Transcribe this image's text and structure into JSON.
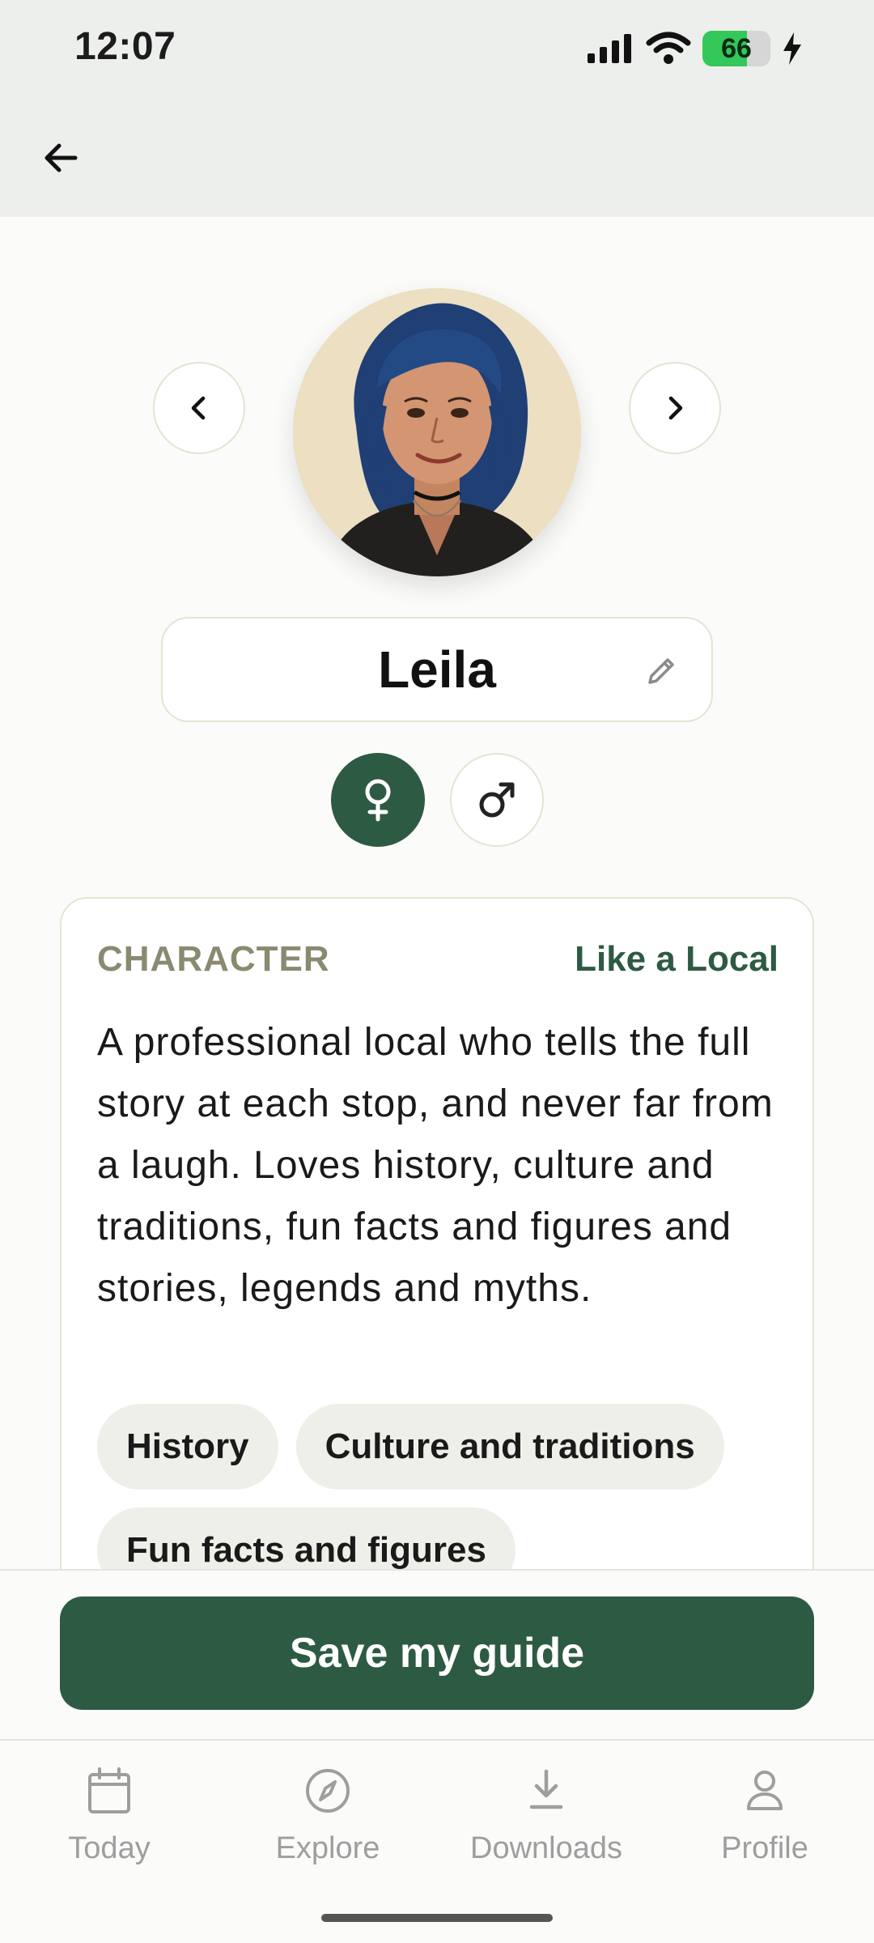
{
  "status": {
    "time": "12:07",
    "battery_level": "66",
    "battery_fraction": 0.66
  },
  "profile": {
    "name": "Leila",
    "gender_selected": "female"
  },
  "character": {
    "label": "CHARACTER",
    "value": "Like a Local",
    "description": "A professional local who tells the full story at each stop, and never far from a laugh. Loves history, culture and traditions, fun facts and figures and stories, legends and myths.",
    "tags": [
      "History",
      "Culture and traditions",
      "Fun facts and figures"
    ]
  },
  "actions": {
    "save_label": "Save my guide"
  },
  "tabs": [
    {
      "label": "Today",
      "icon": "calendar-icon"
    },
    {
      "label": "Explore",
      "icon": "compass-icon"
    },
    {
      "label": "Downloads",
      "icon": "download-icon"
    },
    {
      "label": "Profile",
      "icon": "person-icon"
    }
  ],
  "colors": {
    "accent": "#2d5a43",
    "status_bar_bg": "#ecefeb",
    "battery_green": "#34c759"
  }
}
